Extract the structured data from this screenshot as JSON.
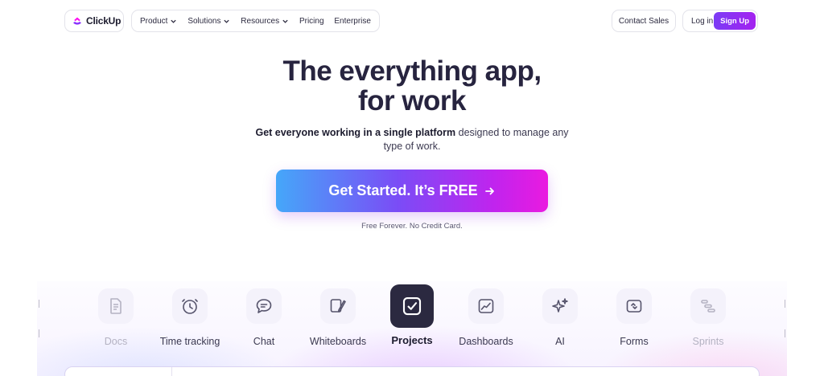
{
  "brand": {
    "name": "ClickUp",
    "colors": [
      "#8930fd",
      "#49ccf9",
      "#ff02f0",
      "#ffc800"
    ]
  },
  "nav": {
    "menu": [
      {
        "label": "Product",
        "has_dropdown": true
      },
      {
        "label": "Solutions",
        "has_dropdown": true
      },
      {
        "label": "Resources",
        "has_dropdown": true
      },
      {
        "label": "Pricing",
        "has_dropdown": false
      },
      {
        "label": "Enterprise",
        "has_dropdown": false
      }
    ],
    "contact_sales": "Contact Sales",
    "login": "Log in",
    "signup": "Sign Up"
  },
  "hero": {
    "title_line1": "The everything app,",
    "title_line2": "for work",
    "subtitle_bold": "Get everyone working in a single platform",
    "subtitle_rest": " designed to manage any",
    "subtitle_line2": "type of work.",
    "cta_label": "Get Started. It’s FREE",
    "cta_icon": "arrow-right-icon",
    "cta_note": "Free Forever. No Credit Card."
  },
  "features": [
    {
      "label": "Docs",
      "icon": "docs-icon",
      "state": "faded"
    },
    {
      "label": "Time tracking",
      "icon": "clock-icon",
      "state": "normal"
    },
    {
      "label": "Chat",
      "icon": "chat-icon",
      "state": "normal"
    },
    {
      "label": "Whiteboards",
      "icon": "whiteboard-icon",
      "state": "normal"
    },
    {
      "label": "Projects",
      "icon": "checkbox-icon",
      "state": "active"
    },
    {
      "label": "Dashboards",
      "icon": "dashboard-icon",
      "state": "normal"
    },
    {
      "label": "AI",
      "icon": "sparkle-icon",
      "state": "normal"
    },
    {
      "label": "Forms",
      "icon": "forms-icon",
      "state": "normal"
    },
    {
      "label": "Sprints",
      "icon": "sprints-icon",
      "state": "faded"
    }
  ],
  "theme": {
    "accent": "#7b3cf5",
    "active_tile": "#2b2940",
    "text": "#1c1b2e"
  }
}
